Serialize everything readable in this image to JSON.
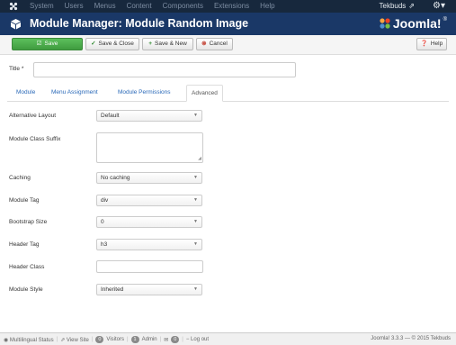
{
  "topbar": {
    "menu": [
      "System",
      "Users",
      "Menus",
      "Content",
      "Components",
      "Extensions",
      "Help"
    ],
    "user": "Tekbuds",
    "logo_icon": "joomla-icon",
    "user_icon": "external-link-icon",
    "settings_icon": "gear-icon"
  },
  "header": {
    "title": "Module Manager: Module Random Image",
    "brand": "Joomla!",
    "brand_reg": "®",
    "icon": "cube-icon"
  },
  "toolbar": {
    "save": "Save",
    "save_close": "Save & Close",
    "save_new": "Save & New",
    "cancel": "Cancel",
    "help": "Help"
  },
  "form": {
    "title_label": "Title *",
    "title_value": ""
  },
  "tabs": [
    "Module",
    "Menu Assignment",
    "Module Permissions",
    "Advanced"
  ],
  "active_tab": "Advanced",
  "fields": {
    "alternative_layout": {
      "label": "Alternative Layout",
      "value": "Default"
    },
    "module_class_suffix": {
      "label": "Module Class Suffix",
      "value": ""
    },
    "caching": {
      "label": "Caching",
      "value": "No caching"
    },
    "module_tag": {
      "label": "Module Tag",
      "value": "div"
    },
    "bootstrap_size": {
      "label": "Bootstrap Size",
      "value": "0"
    },
    "header_tag": {
      "label": "Header Tag",
      "value": "h3"
    },
    "header_class": {
      "label": "Header Class",
      "value": ""
    },
    "module_style": {
      "label": "Module Style",
      "value": "Inherited"
    }
  },
  "status": {
    "multilingual": "Multilingual Status",
    "view_site": "View Site",
    "visitors_count": "0",
    "visitors": "Visitors",
    "admin_count": "1",
    "admin": "Admin",
    "messages_count": "0",
    "logout": "Log out",
    "version": "Joomla! 3.3.3",
    "dash": "—",
    "copyright": "© 2015 Tekbuds"
  },
  "colors": {
    "topbar": "#17283d",
    "header": "#1a3867",
    "save_button": "#4cae4c",
    "link": "#2a69b8"
  }
}
